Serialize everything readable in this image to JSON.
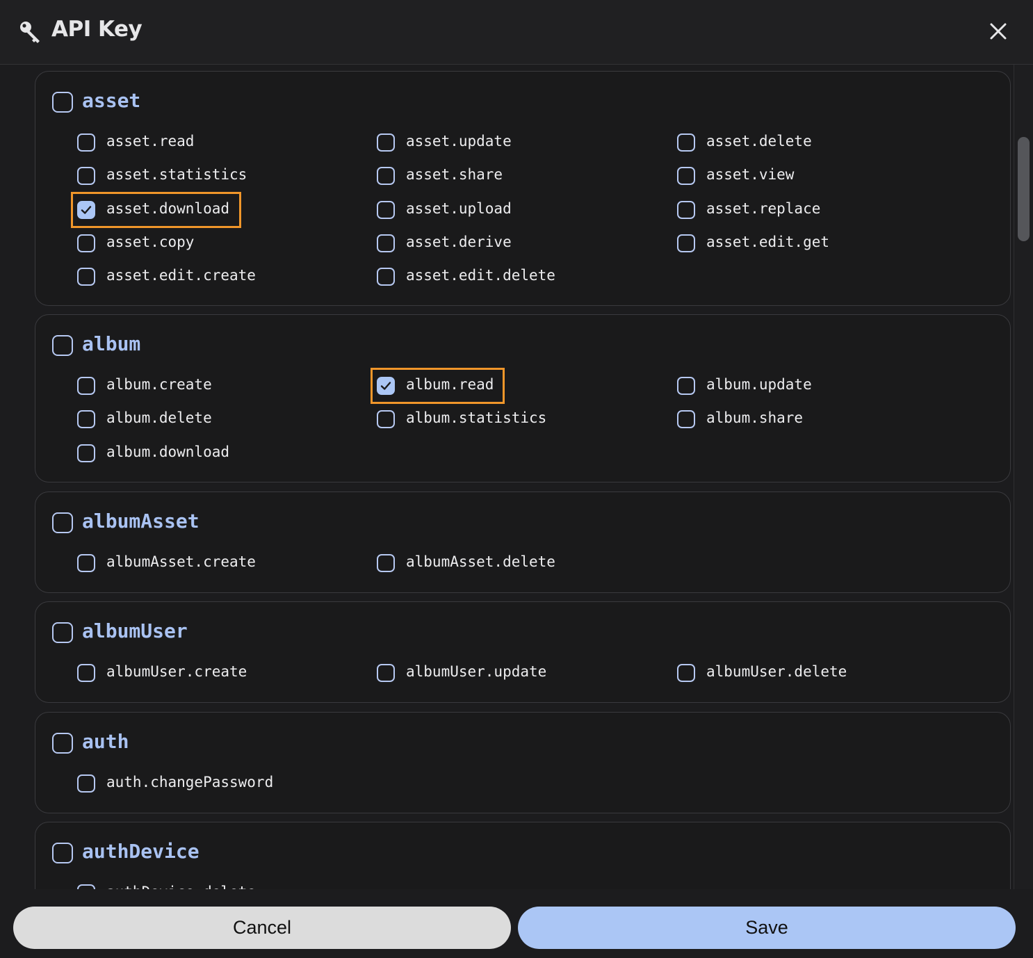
{
  "dialog": {
    "title": "API Key",
    "key_icon": "key-icon",
    "close_icon": "close-icon"
  },
  "groups": [
    {
      "name": "asset",
      "checked": false,
      "permissions": [
        {
          "label": "asset.read",
          "checked": false
        },
        {
          "label": "asset.update",
          "checked": false
        },
        {
          "label": "asset.delete",
          "checked": false
        },
        {
          "label": "asset.statistics",
          "checked": false
        },
        {
          "label": "asset.share",
          "checked": false
        },
        {
          "label": "asset.view",
          "checked": false
        },
        {
          "label": "asset.download",
          "checked": true,
          "highlighted": true
        },
        {
          "label": "asset.upload",
          "checked": false
        },
        {
          "label": "asset.replace",
          "checked": false
        },
        {
          "label": "asset.copy",
          "checked": false
        },
        {
          "label": "asset.derive",
          "checked": false
        },
        {
          "label": "asset.edit.get",
          "checked": false
        },
        {
          "label": "asset.edit.create",
          "checked": false
        },
        {
          "label": "asset.edit.delete",
          "checked": false
        }
      ]
    },
    {
      "name": "album",
      "checked": false,
      "permissions": [
        {
          "label": "album.create",
          "checked": false
        },
        {
          "label": "album.read",
          "checked": true,
          "highlighted": true
        },
        {
          "label": "album.update",
          "checked": false
        },
        {
          "label": "album.delete",
          "checked": false
        },
        {
          "label": "album.statistics",
          "checked": false
        },
        {
          "label": "album.share",
          "checked": false
        },
        {
          "label": "album.download",
          "checked": false
        }
      ]
    },
    {
      "name": "albumAsset",
      "checked": false,
      "permissions": [
        {
          "label": "albumAsset.create",
          "checked": false
        },
        {
          "label": "albumAsset.delete",
          "checked": false
        }
      ]
    },
    {
      "name": "albumUser",
      "checked": false,
      "permissions": [
        {
          "label": "albumUser.create",
          "checked": false
        },
        {
          "label": "albumUser.update",
          "checked": false
        },
        {
          "label": "albumUser.delete",
          "checked": false
        }
      ]
    },
    {
      "name": "auth",
      "checked": false,
      "permissions": [
        {
          "label": "auth.changePassword",
          "checked": false
        }
      ]
    },
    {
      "name": "authDevice",
      "checked": false,
      "permissions": [
        {
          "label": "authDevice.delete",
          "checked": false
        }
      ]
    }
  ],
  "footer": {
    "cancel_label": "Cancel",
    "save_label": "Save"
  },
  "colors": {
    "accent": "#abc6f5",
    "highlight": "#f0962a",
    "background": "#1c1c1e"
  }
}
